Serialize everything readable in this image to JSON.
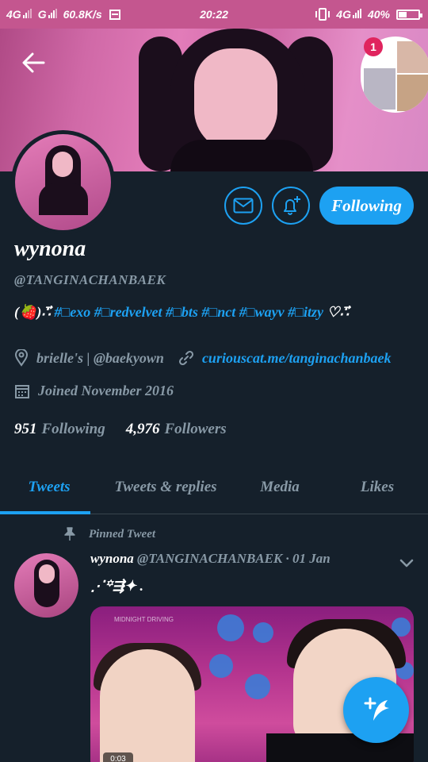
{
  "status_bar": {
    "net1": "4G",
    "net2": "G",
    "speed": "60.8K/s",
    "time": "20:22",
    "net3": "4G",
    "battery": "40%",
    "battery_level": 0.4
  },
  "header": {
    "notification_count": "1"
  },
  "profile": {
    "name": "wynona",
    "handle": "@TANGINACHANBAEK",
    "bio_prefix": "(🍓)∴⃗",
    "bio_tags": "#□exo #□redvelvet #□bts #□nct #□wayv #□itzy",
    "bio_suffix": "♡∴⃗",
    "location": "brielle's | @baekyown",
    "link": "curiouscat.me/tanginachanbaek",
    "joined": "Joined November 2016",
    "following_count": "951",
    "following_label": "Following",
    "followers_count": "4,976",
    "followers_label": "Followers"
  },
  "actions": {
    "follow_label": "Following"
  },
  "tabs": [
    {
      "label": "Tweets"
    },
    {
      "label": "Tweets & replies"
    },
    {
      "label": "Media"
    },
    {
      "label": "Likes"
    }
  ],
  "tweet": {
    "pinned_label": "Pinned Tweet",
    "author": "wynona",
    "handle_date": "@TANGINACHANBAEK · 01 Jan",
    "text": "⋰꙳⇶✦   .",
    "media_caption": "MIDNIGHT DRIVING",
    "media_duration": "0:03"
  },
  "colors": {
    "accent": "#1da1f2",
    "background": "#15202b",
    "secondary_text": "#8899a6",
    "status_bar": "#c4568f"
  }
}
